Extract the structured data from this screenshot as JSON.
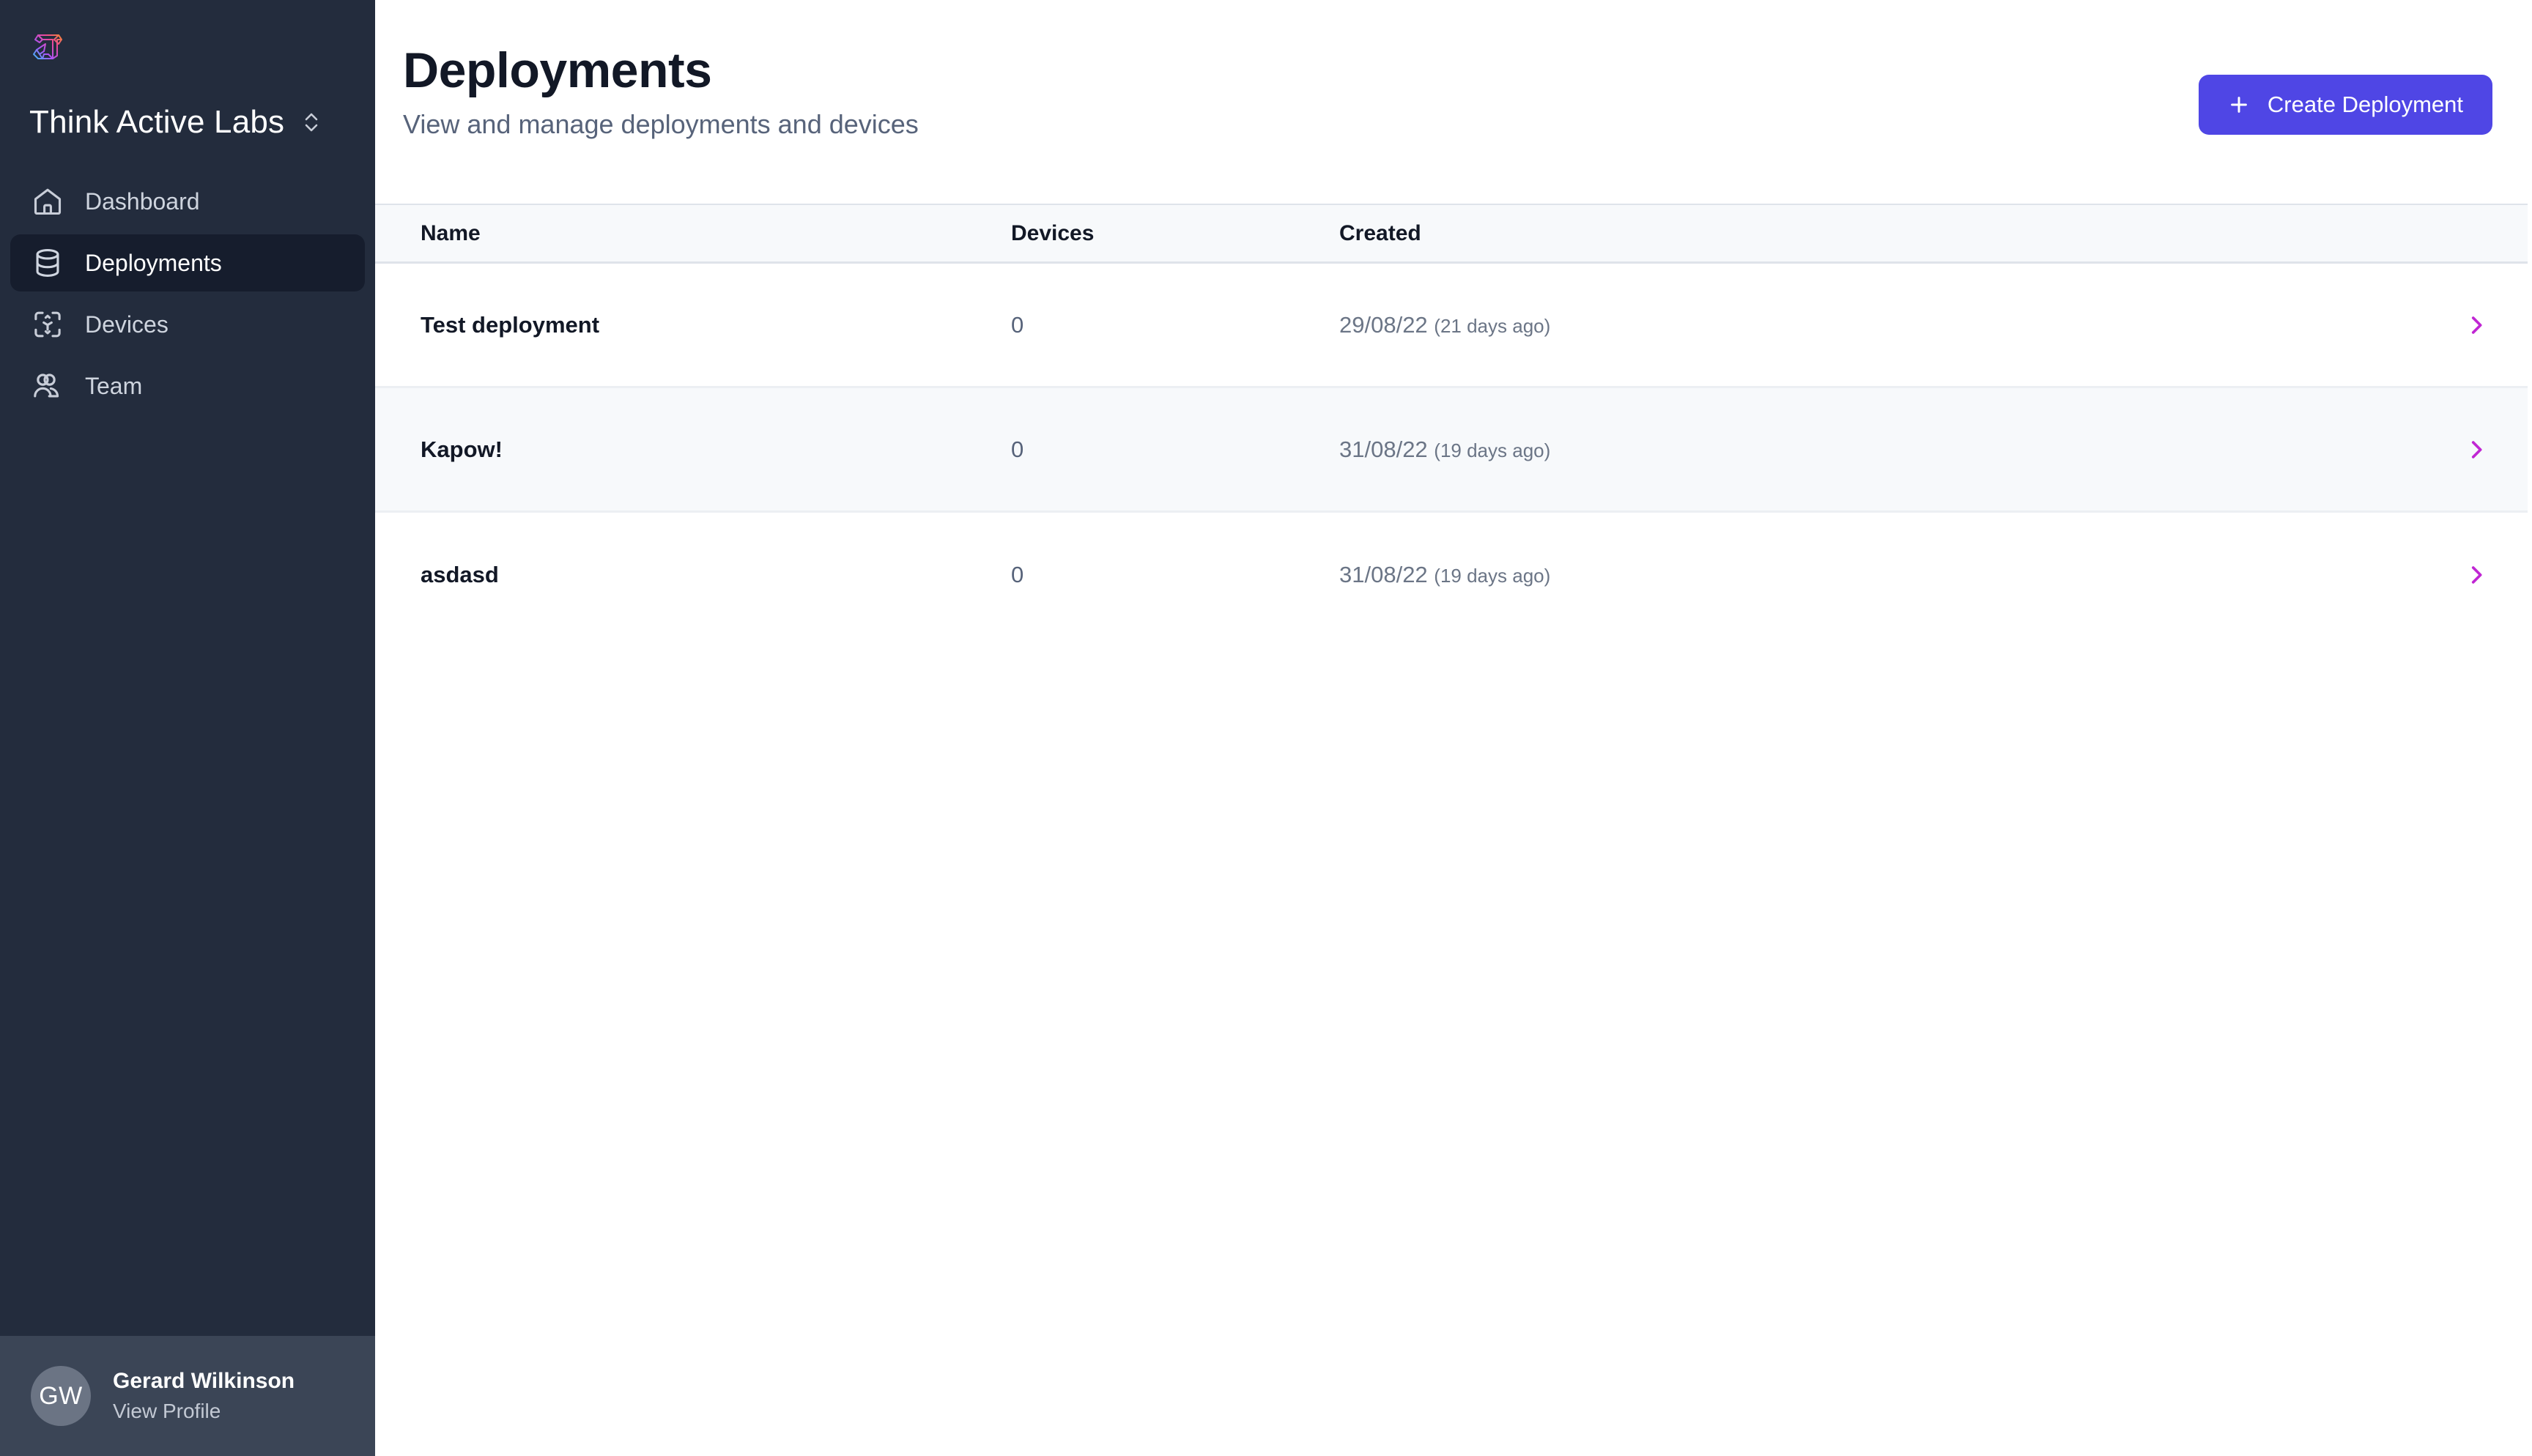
{
  "brand": {
    "logo_icon": "think-active-labs-logo-icon",
    "org_name": "Think Active Labs",
    "org_switcher_icon": "chevron-up-down-icon",
    "accent_color": "#4f46e5",
    "chevron_color": "#c026d3",
    "sidebar_bg": "#232c3d",
    "sidebar_active_bg": "#161d2d"
  },
  "sidebar": {
    "items": [
      {
        "label": "Dashboard",
        "icon": "home-icon",
        "active": false
      },
      {
        "label": "Deployments",
        "icon": "database-icon",
        "active": true
      },
      {
        "label": "Devices",
        "icon": "node-icon",
        "active": false
      },
      {
        "label": "Team",
        "icon": "users-icon",
        "active": false
      }
    ],
    "profile": {
      "initials": "GW",
      "name": "Gerard Wilkinson",
      "link_label": "View Profile"
    }
  },
  "header": {
    "title": "Deployments",
    "subtitle": "View and manage deployments and devices",
    "create_button": {
      "label": "Create Deployment",
      "icon": "plus-icon"
    }
  },
  "table": {
    "columns": [
      {
        "key": "name",
        "label": "Name"
      },
      {
        "key": "devices",
        "label": "Devices"
      },
      {
        "key": "created",
        "label": "Created"
      }
    ],
    "row_chevron_icon": "chevron-right-icon",
    "rows": [
      {
        "name": "Test deployment",
        "devices": "0",
        "created_date": "29/08/22",
        "created_relative": "(21 days ago)"
      },
      {
        "name": "Kapow!",
        "devices": "0",
        "created_date": "31/08/22",
        "created_relative": "(19 days ago)"
      },
      {
        "name": "asdasd",
        "devices": "0",
        "created_date": "31/08/22",
        "created_relative": "(19 days ago)"
      }
    ]
  }
}
